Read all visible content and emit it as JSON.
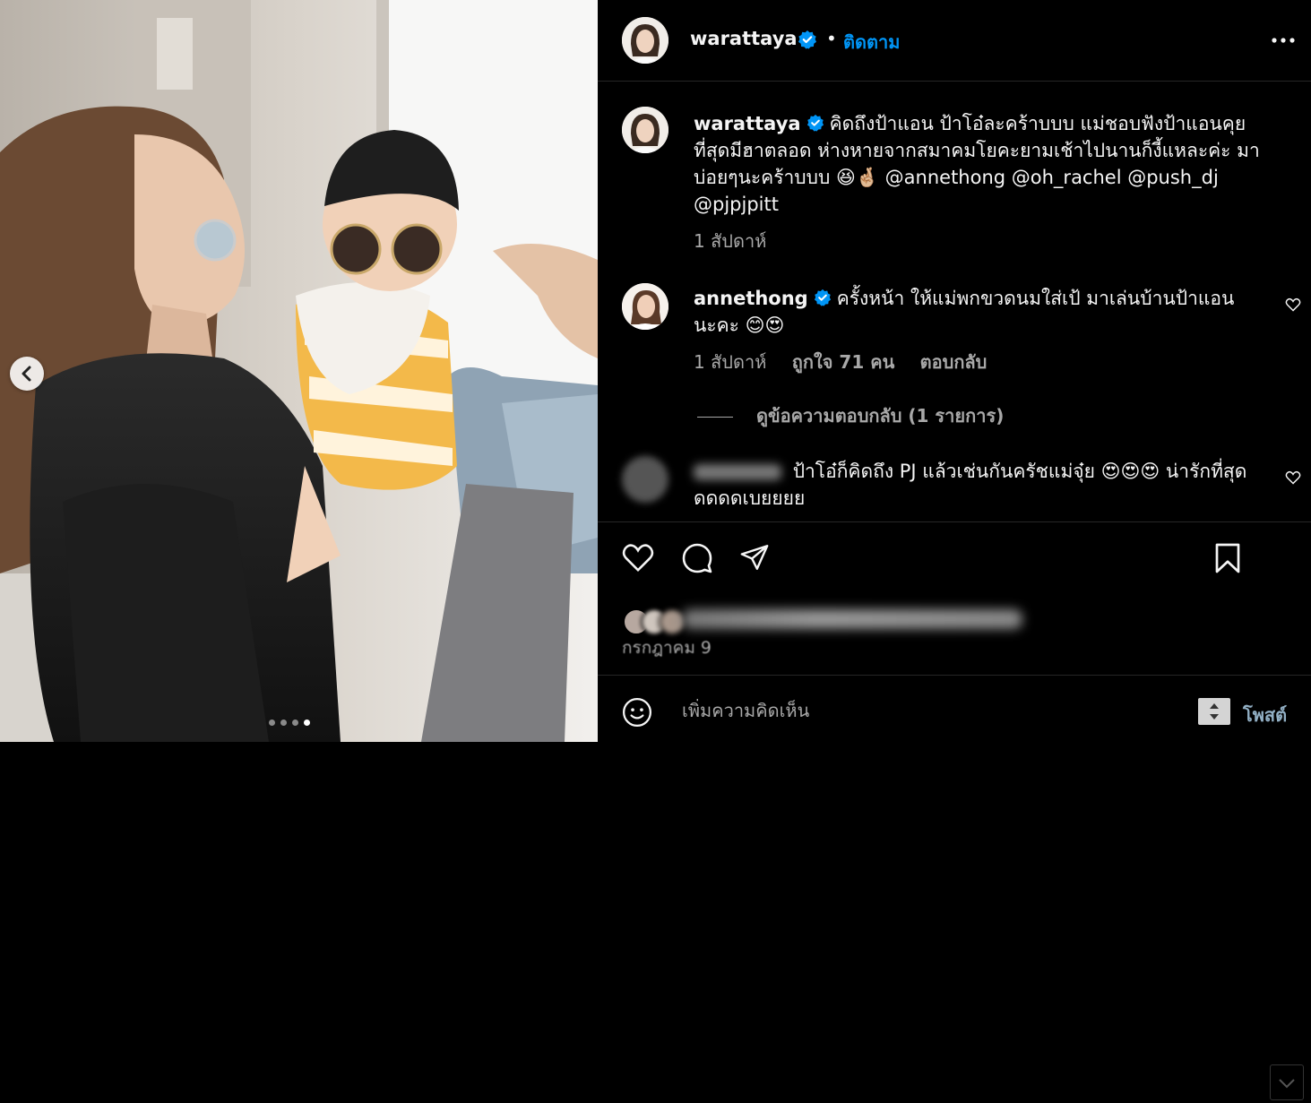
{
  "photo": {
    "carousel": {
      "dot_count": 4,
      "active_index": 3
    }
  },
  "header": {
    "username": "warattaya",
    "separator": "•",
    "follow_label": "ติดตาม"
  },
  "caption": {
    "username": "warattaya",
    "text": "คิดถึงป้าแอน ป้าโอ๋ละคร้าบบบ แม่ชอบฟังป้าแอนคุยที่สุดมีฮาตลอด ห่างหายจากสมาคมโยคะยามเช้าไปนานก็งี้แหละค่ะ มาบ่อยๆนะคร้าบบบ 😆🤞🏼 @annethong @oh_rachel @push_dj @pjpjpitt",
    "time": "1 สัปดาห์"
  },
  "comments": [
    {
      "username": "annethong",
      "text": "ครั้งหน้า ให้แม่พกขวดนมใส่เป้ มาเล่นบ้านป้าแอน นะคะ 😊😍",
      "time": "1 สัปดาห์",
      "likes": "ถูกใจ 71 คน",
      "reply_label": "ตอบกลับ",
      "view_replies": "ดูข้อความตอบกลับ (1 รายการ)"
    },
    {
      "username": "",
      "text": "ป้าโอ๋ก็คิดถึง PJ แล้วเช่นกันครัชแม่จุ๋ย 😍😍😍 น่ารักที่สุดดดดดเบยยยย"
    }
  ],
  "footer": {
    "date": "กรกฎาคม 9",
    "comment_placeholder": "เพิ่มความคิดเห็น",
    "post_label": "โพสต์"
  },
  "icons": {
    "verified": "verified-badge-icon",
    "more": "more-options-icon",
    "like": "heart-icon",
    "comment": "comment-icon",
    "share": "share-icon",
    "save": "bookmark-icon",
    "emoji": "emoji-icon",
    "prev": "chevron-left-icon"
  },
  "colors": {
    "accent": "#0095f6",
    "background": "#000000",
    "muted": "#a8a8a8"
  }
}
